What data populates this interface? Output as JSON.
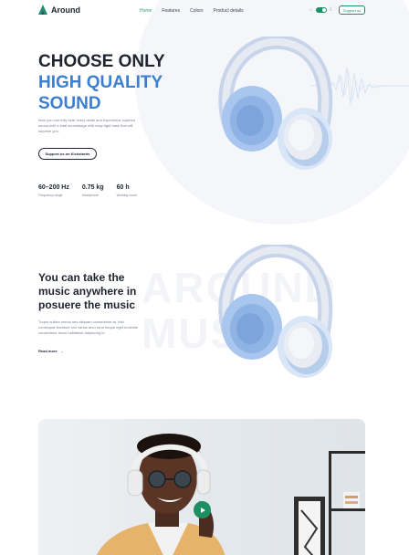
{
  "nav": {
    "logo": "Around",
    "links": [
      "Home",
      "Features",
      "Colors",
      "Product details"
    ],
    "active_link": "Home",
    "support_label": "Support us"
  },
  "hero": {
    "title_line1": "CHOOSE ONLY",
    "title_line2": "HIGH QUALITY",
    "title_line3": "SOUND",
    "description": "Now you can fully hear every detail and experience superior sound with a total soundstage with easy tight bass that will surprise you.",
    "cta_label": "Support us on Kickstarter",
    "stats": [
      {
        "value": "60–200 Hz",
        "label": "Frequency range"
      },
      {
        "value": "0.75 kg",
        "label": "Headphone"
      },
      {
        "value": "60 h",
        "label": "Working hours"
      }
    ]
  },
  "section2": {
    "watermark_line1": "AROUND",
    "watermark_line2": "MUSIC",
    "title": "You can take the music anywhere in posuere the music",
    "description": "Turpis nullam metus sed aliquam consectetur at. Nisi consequat tincidunt orci varius arcu urna neque eget molestie consectetur lacus habitasse adipiscing in.",
    "read_more": "Read more",
    "read_more_arrow": "→"
  },
  "colors": {
    "accent_green": "#1e8e63",
    "accent_blue": "#3c7fd0",
    "text_dark": "#1f2430"
  },
  "icons": {
    "sun": "☼",
    "moon": "☾"
  }
}
